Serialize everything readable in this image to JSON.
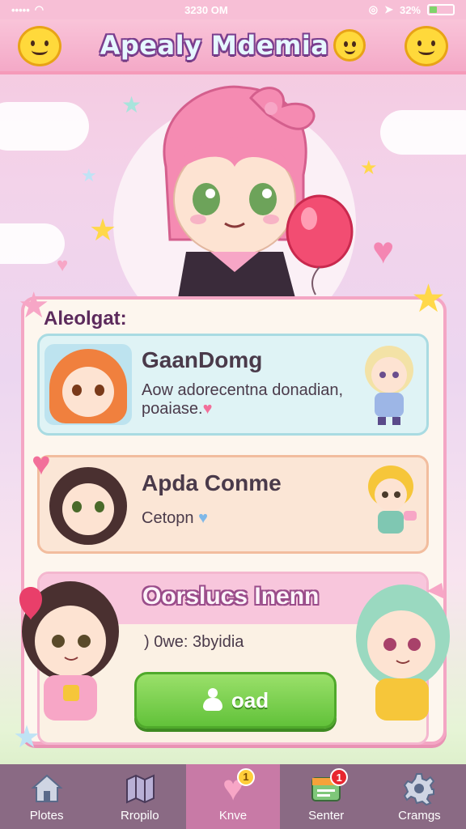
{
  "status_bar": {
    "time": "3230 OM",
    "battery": "32%"
  },
  "header": {
    "title": "Apealy Mdemia"
  },
  "panel": {
    "heading": "Aleolgat:",
    "cards": [
      {
        "title": "GaanDomg",
        "subtitle_line1": "Aow adorecentna donadian,",
        "subtitle_line2": "poaiase.",
        "heart": "♥"
      },
      {
        "title": "Apda Conme",
        "subtitle": "Cetopn",
        "heart": "♥"
      },
      {
        "title": "Oorslucs Inenn",
        "subtitle": ") 0we: 3byidia"
      }
    ],
    "action_button": {
      "label": "oad"
    }
  },
  "bottom_nav": {
    "items": [
      {
        "label": "Plotes",
        "icon": "house-icon"
      },
      {
        "label": "Rropilo",
        "icon": "map-icon"
      },
      {
        "label": "Knve",
        "icon": "heart-icon",
        "badge": "1",
        "active": true
      },
      {
        "label": "Senter",
        "icon": "calendar-icon",
        "badge": "1"
      },
      {
        "label": "Cramgs",
        "icon": "gear-icon"
      }
    ]
  },
  "colors": {
    "header_pink": "#f4a9c7",
    "panel_border": "#f4a6c4",
    "button_green": "#62c23a",
    "nav_bg": "#8a6a84",
    "nav_active": "#c87aa6"
  }
}
